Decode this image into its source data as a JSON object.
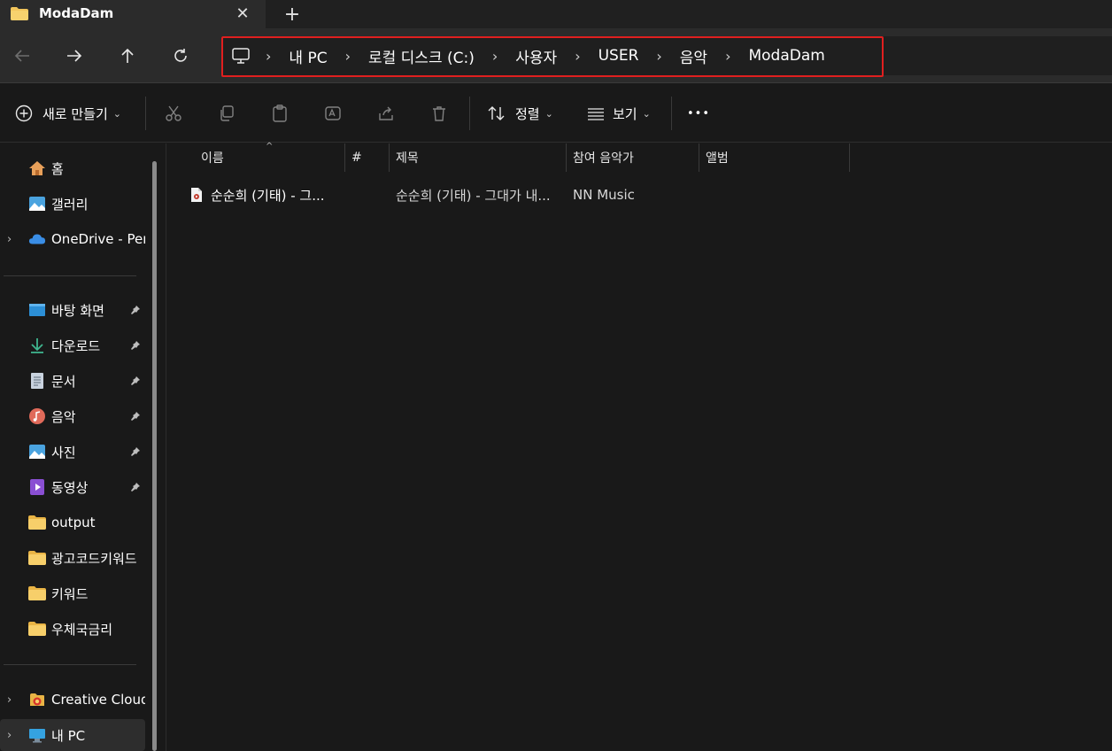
{
  "window": {
    "tab_title": "ModaDam",
    "close_glyph": "✕",
    "new_tab_glyph": "+"
  },
  "breadcrumb": {
    "items": [
      "내 PC",
      "로컬 디스크 (C:)",
      "사용자",
      "USER",
      "음악",
      "ModaDam"
    ],
    "separator": "›"
  },
  "commands": {
    "new_label": "새로 만들기",
    "sort_label": "정렬",
    "view_label": "보기",
    "more_label": "•••",
    "caret": "⌄"
  },
  "sidebar": {
    "top": [
      {
        "label": "홈",
        "icon": "home-icon"
      },
      {
        "label": "갤러리",
        "icon": "gallery-icon"
      },
      {
        "label": "OneDrive - Pers",
        "icon": "onedrive-icon",
        "expandable": true
      }
    ],
    "pinned": [
      {
        "label": "바탕 화면",
        "icon": "desktop-icon",
        "pinned": true
      },
      {
        "label": "다운로드",
        "icon": "download-icon",
        "pinned": true
      },
      {
        "label": "문서",
        "icon": "documents-icon",
        "pinned": true
      },
      {
        "label": "음악",
        "icon": "music-icon",
        "pinned": true
      },
      {
        "label": "사진",
        "icon": "pictures-icon",
        "pinned": true
      },
      {
        "label": "동영상",
        "icon": "videos-icon",
        "pinned": true
      },
      {
        "label": "output",
        "icon": "folder-icon"
      },
      {
        "label": "광고코드키워드",
        "icon": "folder-icon"
      },
      {
        "label": "키워드",
        "icon": "folder-icon"
      },
      {
        "label": "우체국금리",
        "icon": "folder-icon"
      }
    ],
    "bottom": [
      {
        "label": "Creative Cloud",
        "icon": "creative-cloud-icon",
        "expandable": true
      },
      {
        "label": "내 PC",
        "icon": "this-pc-icon",
        "expandable": true,
        "selected": true
      }
    ],
    "chevron": "›"
  },
  "file_list": {
    "columns": [
      "이름",
      "#",
      "제목",
      "참여 음악가",
      "앨범"
    ],
    "sort_indicator": "^",
    "rows": [
      {
        "name": "순순희 (기태) - 그...",
        "number": "",
        "title": "순순희 (기태) - 그대가 내...",
        "artist": "NN Music",
        "album": ""
      }
    ]
  },
  "colors": {
    "background": "#191919",
    "navbar": "#2b2b2b",
    "highlight": "#e01f1f",
    "folder": "#f2c55c"
  }
}
